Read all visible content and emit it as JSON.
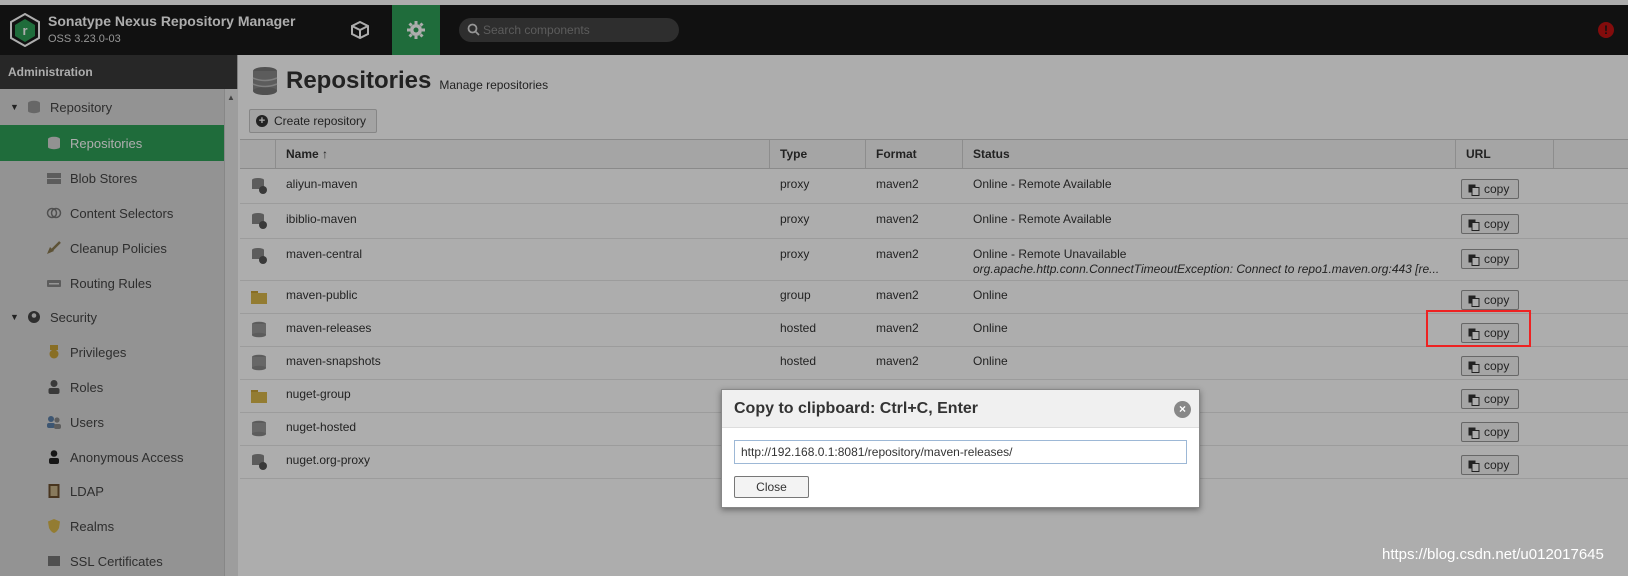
{
  "header": {
    "title": "Sonatype Nexus Repository Manager",
    "version": "OSS 3.23.0-03",
    "search_placeholder": "Search components",
    "alert_symbol": "!"
  },
  "sidebar": {
    "heading": "Administration",
    "items": [
      {
        "label": "Repository",
        "type": "group",
        "icon": "database-icon"
      },
      {
        "label": "Repositories",
        "type": "child",
        "icon": "database-icon",
        "active": true
      },
      {
        "label": "Blob Stores",
        "type": "child",
        "icon": "server-icon"
      },
      {
        "label": "Content Selectors",
        "type": "child",
        "icon": "layers-icon"
      },
      {
        "label": "Cleanup Policies",
        "type": "child",
        "icon": "brush-icon"
      },
      {
        "label": "Routing Rules",
        "type": "child",
        "icon": "drive-icon"
      },
      {
        "label": "Security",
        "type": "group",
        "icon": "badge-icon"
      },
      {
        "label": "Privileges",
        "type": "child",
        "icon": "medal-icon"
      },
      {
        "label": "Roles",
        "type": "child",
        "icon": "person-tie-icon"
      },
      {
        "label": "Users",
        "type": "child",
        "icon": "users-icon"
      },
      {
        "label": "Anonymous Access",
        "type": "child",
        "icon": "user-icon"
      },
      {
        "label": "LDAP",
        "type": "child",
        "icon": "book-icon"
      },
      {
        "label": "Realms",
        "type": "child",
        "icon": "shield-icon"
      },
      {
        "label": "SSL Certificates",
        "type": "child",
        "icon": "certificate-icon"
      }
    ]
  },
  "main": {
    "title": "Repositories",
    "subtitle": "Manage repositories",
    "create_label": "Create repository",
    "columns": {
      "name": "Name",
      "sort": "↑",
      "type": "Type",
      "format": "Format",
      "status": "Status",
      "url": "URL"
    },
    "copy_label": "copy",
    "rows": [
      {
        "name": "aliyun-maven",
        "type": "proxy",
        "format": "maven2",
        "status": "Online - Remote Available",
        "status_sub": "",
        "icon": "proxy-icon"
      },
      {
        "name": "ibiblio-maven",
        "type": "proxy",
        "format": "maven2",
        "status": "Online - Remote Available",
        "status_sub": "",
        "icon": "proxy-icon"
      },
      {
        "name": "maven-central",
        "type": "proxy",
        "format": "maven2",
        "status": "Online - Remote Unavailable",
        "status_sub": "org.apache.http.conn.ConnectTimeoutException: Connect to repo1.maven.org:443 [re...",
        "icon": "proxy-icon"
      },
      {
        "name": "maven-public",
        "type": "group",
        "format": "maven2",
        "status": "Online",
        "status_sub": "",
        "icon": "folder-icon"
      },
      {
        "name": "maven-releases",
        "type": "hosted",
        "format": "maven2",
        "status": "Online",
        "status_sub": "",
        "icon": "database-icon"
      },
      {
        "name": "maven-snapshots",
        "type": "hosted",
        "format": "maven2",
        "status": "Online",
        "status_sub": "",
        "icon": "database-icon"
      },
      {
        "name": "nuget-group",
        "type": "",
        "format": "",
        "status": "",
        "status_sub": "",
        "icon": "folder-icon"
      },
      {
        "name": "nuget-hosted",
        "type": "",
        "format": "",
        "status": "",
        "status_sub": "",
        "icon": "database-icon"
      },
      {
        "name": "nuget.org-proxy",
        "type": "",
        "format": "",
        "status": "",
        "status_sub": "",
        "icon": "proxy-icon"
      }
    ]
  },
  "modal": {
    "title": "Copy to clipboard: Ctrl+C, Enter",
    "url_value": "http://192.168.0.1:8081/repository/maven-releases/",
    "close_label": "Close"
  },
  "watermark": "https://blog.csdn.net/u012017645",
  "colors": {
    "accent": "#2fa057",
    "header_bg": "#1a1a1a",
    "highlight": "#e22222",
    "alert": "#c21313"
  }
}
